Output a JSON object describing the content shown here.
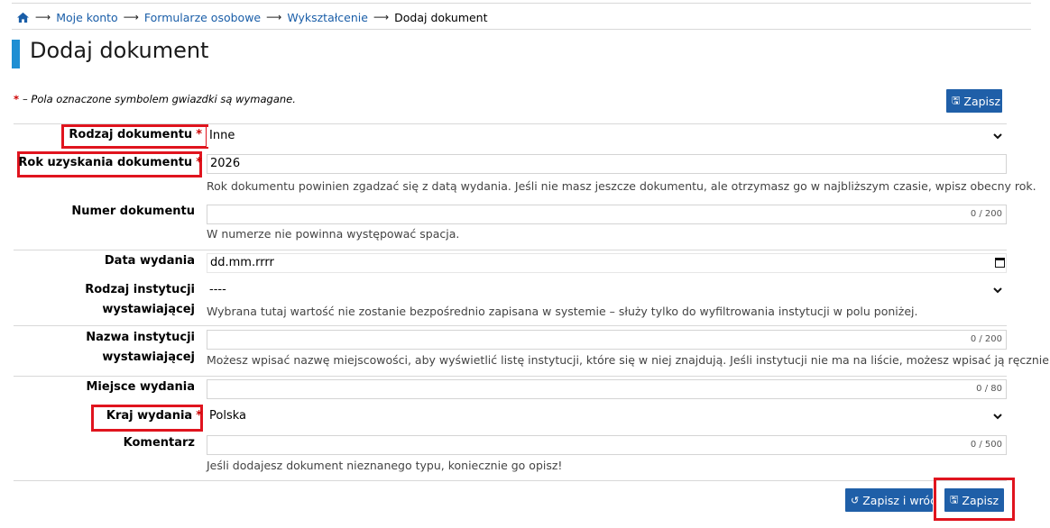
{
  "breadcrumb": {
    "items": [
      "Moje konto",
      "Formularze osobowe",
      "Wykształcenie"
    ],
    "current": "Dodaj dokument"
  },
  "page": {
    "title": "Dodaj dokument",
    "required_note": "– Pola oznaczone symbolem gwiazdki są wymagane.",
    "required_symbol": "*"
  },
  "buttons": {
    "save_top": "Zapisz",
    "save_and_back": "Zapisz i wróć",
    "save_bottom": "Zapisz"
  },
  "form": {
    "doc_type": {
      "label": "Rodzaj dokumentu",
      "value": "Inne"
    },
    "year": {
      "label": "Rok uzyskania dokumentu",
      "value": "2026",
      "help": "Rok dokumentu powinien zgadzać się z datą wydania. Jeśli nie masz jeszcze dokumentu, ale otrzymasz go w najbliższym czasie, wpisz obecny rok."
    },
    "doc_number": {
      "label": "Numer dokumentu",
      "value": "",
      "counter": "0 / 200",
      "help": "W numerze nie powinna występować spacja."
    },
    "issue_date": {
      "label": "Data wydania",
      "value": "dd.mm.rrrr"
    },
    "inst_type": {
      "label_line1": "Rodzaj instytucji",
      "label_line2": "wystawiającej",
      "value": "----",
      "help": "Wybrana tutaj wartość nie zostanie bezpośrednio zapisana w systemie – służy tylko do wyfiltrowania instytucji w polu poniżej."
    },
    "inst_name": {
      "label_line1": "Nazwa instytucji",
      "label_line2": "wystawiającej",
      "value": "",
      "counter": "0 / 200",
      "help": "Możesz wpisać nazwę miejscowości, aby wyświetlić listę instytucji, które się w niej znajdują. Jeśli instytucji nie ma na liście, możesz wpisać ją ręcznie."
    },
    "place": {
      "label": "Miejsce wydania",
      "value": "",
      "counter": "0 / 80"
    },
    "country": {
      "label": "Kraj wydania",
      "value": "Polska"
    },
    "comment": {
      "label": "Komentarz",
      "value": "",
      "counter": "0 / 500",
      "help": "Jeśli dodajesz dokument nieznanego typu, koniecznie go opisz!"
    }
  },
  "colors": {
    "accent": "#1f8fd3",
    "button": "#1f5fa8",
    "link": "#1a5ea8",
    "required": "#cc0000",
    "highlight": "#e0141e"
  }
}
